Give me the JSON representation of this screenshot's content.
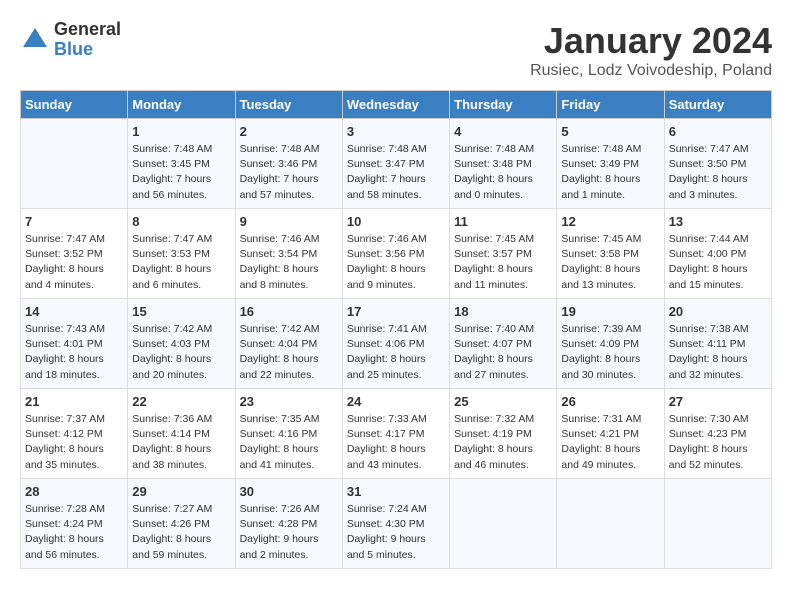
{
  "header": {
    "logo_general": "General",
    "logo_blue": "Blue",
    "title": "January 2024",
    "subtitle": "Rusiec, Lodz Voivodeship, Poland"
  },
  "weekdays": [
    "Sunday",
    "Monday",
    "Tuesday",
    "Wednesday",
    "Thursday",
    "Friday",
    "Saturday"
  ],
  "weeks": [
    [
      {
        "day": "",
        "sunrise": "",
        "sunset": "",
        "daylight": ""
      },
      {
        "day": "1",
        "sunrise": "Sunrise: 7:48 AM",
        "sunset": "Sunset: 3:45 PM",
        "daylight": "Daylight: 7 hours and 56 minutes."
      },
      {
        "day": "2",
        "sunrise": "Sunrise: 7:48 AM",
        "sunset": "Sunset: 3:46 PM",
        "daylight": "Daylight: 7 hours and 57 minutes."
      },
      {
        "day": "3",
        "sunrise": "Sunrise: 7:48 AM",
        "sunset": "Sunset: 3:47 PM",
        "daylight": "Daylight: 7 hours and 58 minutes."
      },
      {
        "day": "4",
        "sunrise": "Sunrise: 7:48 AM",
        "sunset": "Sunset: 3:48 PM",
        "daylight": "Daylight: 8 hours and 0 minutes."
      },
      {
        "day": "5",
        "sunrise": "Sunrise: 7:48 AM",
        "sunset": "Sunset: 3:49 PM",
        "daylight": "Daylight: 8 hours and 1 minute."
      },
      {
        "day": "6",
        "sunrise": "Sunrise: 7:47 AM",
        "sunset": "Sunset: 3:50 PM",
        "daylight": "Daylight: 8 hours and 3 minutes."
      }
    ],
    [
      {
        "day": "7",
        "sunrise": "Sunrise: 7:47 AM",
        "sunset": "Sunset: 3:52 PM",
        "daylight": "Daylight: 8 hours and 4 minutes."
      },
      {
        "day": "8",
        "sunrise": "Sunrise: 7:47 AM",
        "sunset": "Sunset: 3:53 PM",
        "daylight": "Daylight: 8 hours and 6 minutes."
      },
      {
        "day": "9",
        "sunrise": "Sunrise: 7:46 AM",
        "sunset": "Sunset: 3:54 PM",
        "daylight": "Daylight: 8 hours and 8 minutes."
      },
      {
        "day": "10",
        "sunrise": "Sunrise: 7:46 AM",
        "sunset": "Sunset: 3:56 PM",
        "daylight": "Daylight: 8 hours and 9 minutes."
      },
      {
        "day": "11",
        "sunrise": "Sunrise: 7:45 AM",
        "sunset": "Sunset: 3:57 PM",
        "daylight": "Daylight: 8 hours and 11 minutes."
      },
      {
        "day": "12",
        "sunrise": "Sunrise: 7:45 AM",
        "sunset": "Sunset: 3:58 PM",
        "daylight": "Daylight: 8 hours and 13 minutes."
      },
      {
        "day": "13",
        "sunrise": "Sunrise: 7:44 AM",
        "sunset": "Sunset: 4:00 PM",
        "daylight": "Daylight: 8 hours and 15 minutes."
      }
    ],
    [
      {
        "day": "14",
        "sunrise": "Sunrise: 7:43 AM",
        "sunset": "Sunset: 4:01 PM",
        "daylight": "Daylight: 8 hours and 18 minutes."
      },
      {
        "day": "15",
        "sunrise": "Sunrise: 7:42 AM",
        "sunset": "Sunset: 4:03 PM",
        "daylight": "Daylight: 8 hours and 20 minutes."
      },
      {
        "day": "16",
        "sunrise": "Sunrise: 7:42 AM",
        "sunset": "Sunset: 4:04 PM",
        "daylight": "Daylight: 8 hours and 22 minutes."
      },
      {
        "day": "17",
        "sunrise": "Sunrise: 7:41 AM",
        "sunset": "Sunset: 4:06 PM",
        "daylight": "Daylight: 8 hours and 25 minutes."
      },
      {
        "day": "18",
        "sunrise": "Sunrise: 7:40 AM",
        "sunset": "Sunset: 4:07 PM",
        "daylight": "Daylight: 8 hours and 27 minutes."
      },
      {
        "day": "19",
        "sunrise": "Sunrise: 7:39 AM",
        "sunset": "Sunset: 4:09 PM",
        "daylight": "Daylight: 8 hours and 30 minutes."
      },
      {
        "day": "20",
        "sunrise": "Sunrise: 7:38 AM",
        "sunset": "Sunset: 4:11 PM",
        "daylight": "Daylight: 8 hours and 32 minutes."
      }
    ],
    [
      {
        "day": "21",
        "sunrise": "Sunrise: 7:37 AM",
        "sunset": "Sunset: 4:12 PM",
        "daylight": "Daylight: 8 hours and 35 minutes."
      },
      {
        "day": "22",
        "sunrise": "Sunrise: 7:36 AM",
        "sunset": "Sunset: 4:14 PM",
        "daylight": "Daylight: 8 hours and 38 minutes."
      },
      {
        "day": "23",
        "sunrise": "Sunrise: 7:35 AM",
        "sunset": "Sunset: 4:16 PM",
        "daylight": "Daylight: 8 hours and 41 minutes."
      },
      {
        "day": "24",
        "sunrise": "Sunrise: 7:33 AM",
        "sunset": "Sunset: 4:17 PM",
        "daylight": "Daylight: 8 hours and 43 minutes."
      },
      {
        "day": "25",
        "sunrise": "Sunrise: 7:32 AM",
        "sunset": "Sunset: 4:19 PM",
        "daylight": "Daylight: 8 hours and 46 minutes."
      },
      {
        "day": "26",
        "sunrise": "Sunrise: 7:31 AM",
        "sunset": "Sunset: 4:21 PM",
        "daylight": "Daylight: 8 hours and 49 minutes."
      },
      {
        "day": "27",
        "sunrise": "Sunrise: 7:30 AM",
        "sunset": "Sunset: 4:23 PM",
        "daylight": "Daylight: 8 hours and 52 minutes."
      }
    ],
    [
      {
        "day": "28",
        "sunrise": "Sunrise: 7:28 AM",
        "sunset": "Sunset: 4:24 PM",
        "daylight": "Daylight: 8 hours and 56 minutes."
      },
      {
        "day": "29",
        "sunrise": "Sunrise: 7:27 AM",
        "sunset": "Sunset: 4:26 PM",
        "daylight": "Daylight: 8 hours and 59 minutes."
      },
      {
        "day": "30",
        "sunrise": "Sunrise: 7:26 AM",
        "sunset": "Sunset: 4:28 PM",
        "daylight": "Daylight: 9 hours and 2 minutes."
      },
      {
        "day": "31",
        "sunrise": "Sunrise: 7:24 AM",
        "sunset": "Sunset: 4:30 PM",
        "daylight": "Daylight: 9 hours and 5 minutes."
      },
      {
        "day": "",
        "sunrise": "",
        "sunset": "",
        "daylight": ""
      },
      {
        "day": "",
        "sunrise": "",
        "sunset": "",
        "daylight": ""
      },
      {
        "day": "",
        "sunrise": "",
        "sunset": "",
        "daylight": ""
      }
    ]
  ]
}
